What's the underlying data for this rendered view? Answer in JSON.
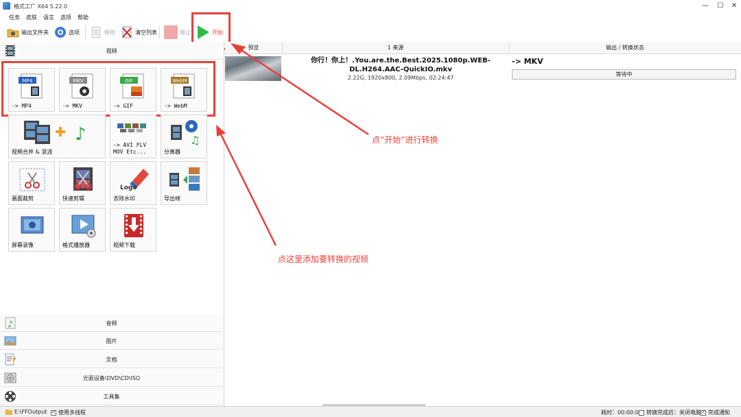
{
  "window": {
    "title": "格式工厂 X64 5.22.0",
    "controls": {
      "minimize": "—",
      "maximize": "☐",
      "close": "✕"
    }
  },
  "menu": {
    "items": [
      "任务",
      "皮肤",
      "语言",
      "选项",
      "帮助"
    ]
  },
  "toolbar": {
    "output_folder": "输出文件夹",
    "options": "选项",
    "remove": "移除",
    "clear_list": "清空列表",
    "stop": "停止",
    "start": "开始"
  },
  "left_panel": {
    "video_category": "视频",
    "video_tiles": [
      "-> MP4",
      "-> MKV",
      "-> GIF",
      "-> WebM"
    ],
    "tile_badges": [
      "MP4",
      "MKV",
      "GIF",
      "WebM"
    ],
    "tool_tiles": [
      "视频合并 & 混流",
      "-> AVI FLV\nMOV Etc...",
      "分离器",
      "画面裁剪",
      "快速剪辑",
      "去除水印",
      "导出帧",
      "屏幕录像",
      "格式播放器",
      "视频下载"
    ],
    "logo_text": "Logo",
    "bottom_categories": [
      "音频",
      "图片",
      "文档",
      "光驱设备\\DVD\\CD\\ISO",
      "工具集"
    ]
  },
  "task_list": {
    "columns": [
      "预览",
      "1 来源",
      "输出 / 转换状态"
    ],
    "rows": [
      {
        "filename": "你行！你上！.You.are.the.Best.2025.1080p.WEB-DL.H264.AAC-QuickIO.mkv",
        "info": "2.22G, 1920x800, 2.09Mbps, 02:24:47",
        "output_format": "-> MKV",
        "status": "等待中"
      }
    ]
  },
  "annotations": {
    "start_hint": "点“开始”进行转换",
    "add_hint": "点这里添加要转换的视频"
  },
  "statusbar": {
    "output_path": "E:\\FFOutput",
    "multithread": "使用多线程",
    "elapsed": "耗时：00:00:00",
    "after_convert": "转换完成后：关闭电脑",
    "notify": "完成通知"
  },
  "colors": {
    "annotation_red": "#e8403a",
    "start_green": "#2fb84a"
  }
}
